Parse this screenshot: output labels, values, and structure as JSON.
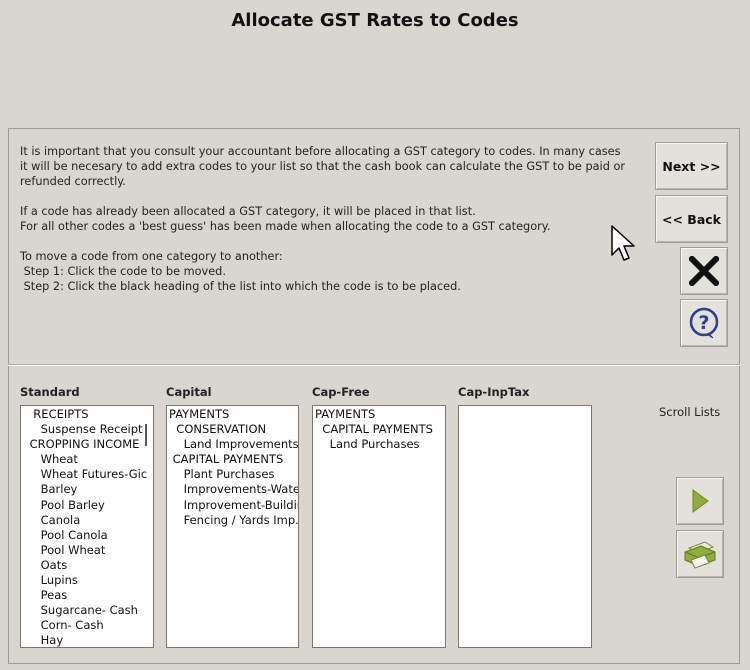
{
  "window": {
    "title": "Allocate GST Rates to Codes"
  },
  "info": {
    "para1": "It is important that you consult your accountant before allocating a GST category to codes. In many cases it will be necesary to add extra codes to your list so that the cash book can calculate the GST to be paid or refunded correctly.",
    "para2_line1": "If a code has already been allocated a GST category, it will be placed in that list.",
    "para2_line2": "For all other codes a 'best guess' has been made when allocating the code to a GST category.",
    "para3_line1": "To move a code from one category to another:",
    "step1": " Step 1: Click the code to be moved.",
    "step2": " Step 2: Click the black heading of the list into which the code is to be placed."
  },
  "buttons": {
    "next": "Next >>",
    "back": "<< Back",
    "close_icon": "close-x-icon",
    "help_icon": "help-question-icon",
    "scroll_icon": "play-right-icon",
    "print_icon": "printer-icon"
  },
  "scroll_label": "Scroll Lists",
  "columns": [
    {
      "heading": "Standard",
      "items": [
        "  RECEIPTS",
        "    Suspense Receipt",
        " CROPPING INCOME",
        "    Wheat",
        "    Wheat Futures-Gic",
        "    Barley",
        "    Pool Barley",
        "    Canola",
        "    Pool Canola",
        "    Pool Wheat",
        "    Oats",
        "    Lupins",
        "    Peas",
        "    Sugarcane- Cash",
        "    Corn- Cash",
        "    Hay"
      ]
    },
    {
      "heading": "Capital",
      "items": [
        "PAYMENTS",
        "  CONSERVATION",
        "    Land Improvements",
        " CAPITAL PAYMENTS",
        "    Plant Purchases",
        "    Improvements-Water",
        "    Improvement-Building",
        "    Fencing / Yards Imp."
      ]
    },
    {
      "heading": "Cap-Free",
      "items": [
        "PAYMENTS",
        "  CAPITAL PAYMENTS",
        "    Land Purchases"
      ]
    },
    {
      "heading": "Cap-InpTax",
      "items": []
    }
  ],
  "colors": {
    "background": "#d9d6cf",
    "accent": "#2b5aa8",
    "icon_green": "#8fae3a"
  }
}
